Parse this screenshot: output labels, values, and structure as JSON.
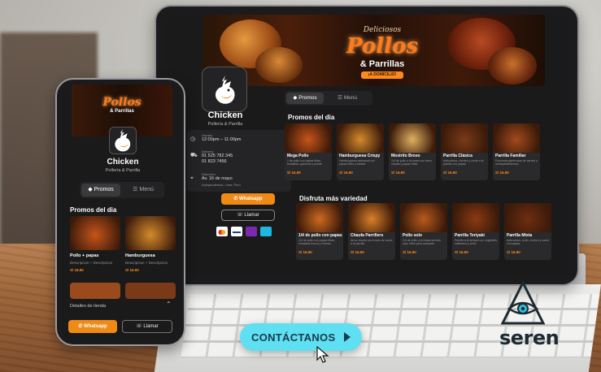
{
  "banner": {
    "script_text": "Deliciosos",
    "title": "Pollos",
    "subtitle": "& Parrillas",
    "badge": "¡A DOMICILIO!"
  },
  "restaurant": {
    "name": "Chicken",
    "tagline": "Pollería & Parrilla"
  },
  "info": {
    "hours_label": "Horario",
    "hours": "12:00pm – 11:00pm",
    "delivery_label": "Delivery",
    "delivery_phones": [
      "01 525 782 345",
      "01 823 7456"
    ],
    "address_label": "Dirección",
    "address": "Av. 16 de mayo",
    "address_detail": "Independencia, Lima, Perú"
  },
  "actions": {
    "whatsapp": "Whatsapp",
    "call": "Llamar"
  },
  "tabs": {
    "promos": "Promos",
    "menu": "Menú"
  },
  "sections": {
    "promos_title": "Promos del dia",
    "variety_title": "Disfruta más variedad"
  },
  "promos": [
    {
      "name": "Mega Pollo",
      "desc": "1 de pollo con papas fritas, ensalada, gaseosa y postre",
      "price": "S/ 16.90",
      "img": "#c7541a"
    },
    {
      "name": "Hamburguesa Crispy",
      "desc": "Hamburguesa artesanal con papas fritas y bebida",
      "price": "S/ 16.90",
      "img": "#d48a2c"
    },
    {
      "name": "Mostrito Broso",
      "desc": "1/4 de pollo a la brasa con arroz chaufa y papas fritas",
      "price": "S/ 16.90",
      "img": "#e0b060"
    },
    {
      "name": "Parrilla Clásica",
      "desc": "Anticuchos, chorizo y carne a la parrilla con papas",
      "price": "S/ 16.90",
      "img": "#7a3a18"
    },
    {
      "name": "Parrilla Familiar",
      "desc": "Porciones generosas de carnes y acompañamientos",
      "price": "S/ 16.90",
      "img": "#a24a1c"
    }
  ],
  "variety": [
    {
      "name": "1/4 de pollo con papas",
      "desc": "1/4 de pollo con papas fritas, ensalada fresca y cremas",
      "price": "S/ 16.90",
      "img": "#cf6a20"
    },
    {
      "name": "Chaufa Parrillero",
      "desc": "Arroz chaufa con trozos de carne a la parrilla",
      "price": "S/ 16.90",
      "img": "#d9802a"
    },
    {
      "name": "Pollo solo",
      "desc": "1/4 de pollo a la brasa servido solo, ideal para compartir",
      "price": "S/ 16.90",
      "img": "#b85a1c"
    },
    {
      "name": "Parrilla Teriyaki",
      "desc": "Parrilla a la teriyaki con vegetales salteados y arroz",
      "price": "S/ 16.90",
      "img": "#8a3a12"
    },
    {
      "name": "Parrilla Mixta",
      "desc": "Anticuchos, pollo, chorizo y carne con papas",
      "price": "S/ 16.90",
      "img": "#6e2e10"
    }
  ],
  "phone_promos": [
    {
      "name": "Pollo + papas",
      "desc": "Descripcion + Descripcion",
      "price": "S/ 16.90",
      "img": "#c7541a"
    },
    {
      "name": "Hamburguesa",
      "desc": "Descripcion + Descripcion",
      "price": "S/ 16.90",
      "img": "#d48a2c"
    }
  ],
  "phone_details": "Detalles de tienda",
  "cta": {
    "label": "CONTÁCTANOS"
  },
  "brand": {
    "name": "seren"
  },
  "colors": {
    "accent_orange": "#f08a16",
    "cta_cyan": "#5ee0f2",
    "panel_dark": "#1a1a1a",
    "price_orange": "#ff8a1a"
  },
  "icons": {
    "clock": "clock-icon",
    "delivery": "motorbike-icon",
    "location": "location-pin-icon",
    "promos": "tag-icon",
    "menu": "menu-list-icon",
    "whatsapp": "whatsapp-icon",
    "phone": "phone-icon",
    "cta_arrow": "triangle-right-icon"
  }
}
